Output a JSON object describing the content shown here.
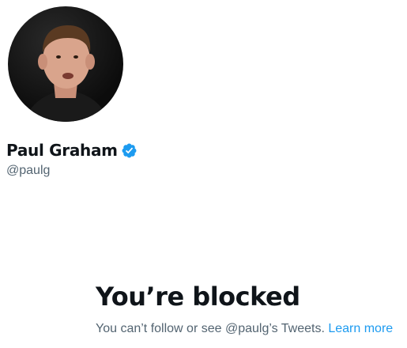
{
  "profile": {
    "display_name": "Paul Graham",
    "handle": "@paulg",
    "verified": true,
    "avatar_icon": "profile-photo"
  },
  "blocked": {
    "title": "You’re blocked",
    "message": "You can’t follow or see @paulg’s Tweets.",
    "link_label": "Learn more"
  },
  "colors": {
    "text_primary": "#0f1419",
    "text_secondary": "#536471",
    "link": "#1d9bf0",
    "verified_badge": "#1d9bf0"
  }
}
